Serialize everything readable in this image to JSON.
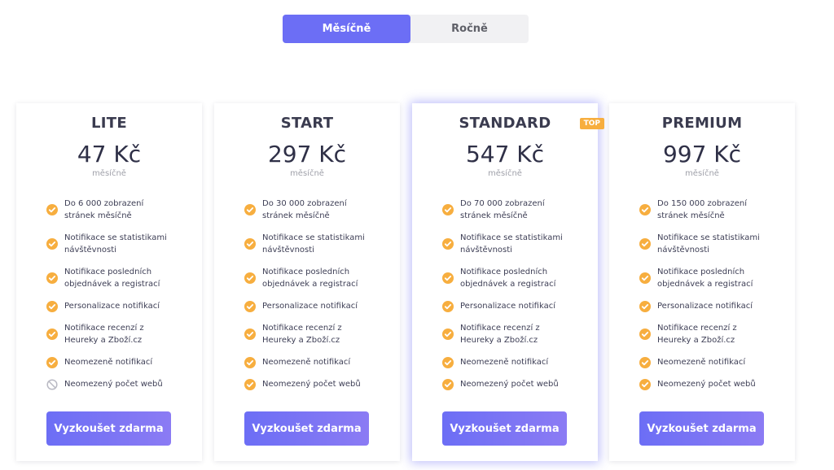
{
  "billing_toggle": {
    "monthly_label": "Měsíčně",
    "yearly_label": "Ročně"
  },
  "colors": {
    "accent": "#6c6ef5",
    "badge": "#f7ae3f",
    "check": "#f7ae3f",
    "disabled": "#b9b9c3"
  },
  "plans": [
    {
      "name": "LITE",
      "price": "47 Kč",
      "period": "měsíčně",
      "button": "Vyzkoušet zdarma",
      "features": [
        {
          "text": "Do 6 000 zobrazení stránek měsíčně",
          "icon": "check-circle-icon"
        },
        {
          "text": "Notifikace se statistikami návštěvnosti",
          "icon": "check-circle-icon"
        },
        {
          "text": "Notifikace posledních objednávek a registrací",
          "icon": "check-circle-icon"
        },
        {
          "text": "Personalizace notifikací",
          "icon": "check-circle-icon"
        },
        {
          "text": "Notifikace recenzí z Heureky a Zboží.cz",
          "icon": "check-circle-icon"
        },
        {
          "text": "Neomezeně notifikací",
          "icon": "check-circle-icon"
        },
        {
          "text": "Neomezený počet webů",
          "icon": "not-allowed-icon"
        }
      ]
    },
    {
      "name": "START",
      "price": "297 Kč",
      "period": "měsíčně",
      "button": "Vyzkoušet zdarma",
      "features": [
        {
          "text": "Do 30 000 zobrazení stránek měsíčně",
          "icon": "check-circle-icon"
        },
        {
          "text": "Notifikace se statistikami návštěvnosti",
          "icon": "check-circle-icon"
        },
        {
          "text": "Notifikace posledních objednávek a registrací",
          "icon": "check-circle-icon"
        },
        {
          "text": "Personalizace notifikací",
          "icon": "check-circle-icon"
        },
        {
          "text": "Notifikace recenzí z Heureky a Zboží.cz",
          "icon": "check-circle-icon"
        },
        {
          "text": "Neomezeně notifikací",
          "icon": "check-circle-icon"
        },
        {
          "text": "Neomezený počet webů",
          "icon": "check-circle-icon"
        }
      ]
    },
    {
      "name": "STANDARD",
      "badge": "TOP",
      "price": "547 Kč",
      "period": "měsíčně",
      "button": "Vyzkoušet zdarma",
      "features": [
        {
          "text": "Do 70 000 zobrazení stránek měsíčně",
          "icon": "check-circle-icon"
        },
        {
          "text": "Notifikace se statistikami návštěvnosti",
          "icon": "check-circle-icon"
        },
        {
          "text": "Notifikace posledních objednávek a registrací",
          "icon": "check-circle-icon"
        },
        {
          "text": "Personalizace notifikací",
          "icon": "check-circle-icon"
        },
        {
          "text": "Notifikace recenzí z Heureky a Zboží.cz",
          "icon": "check-circle-icon"
        },
        {
          "text": "Neomezeně notifikací",
          "icon": "check-circle-icon"
        },
        {
          "text": "Neomezený počet webů",
          "icon": "check-circle-icon"
        }
      ]
    },
    {
      "name": "PREMIUM",
      "price": "997 Kč",
      "period": "měsíčně",
      "button": "Vyzkoušet zdarma",
      "features": [
        {
          "text": "Do 150 000 zobrazení stránek měsíčně",
          "icon": "check-circle-icon"
        },
        {
          "text": "Notifikace se statistikami návštěvnosti",
          "icon": "check-circle-icon"
        },
        {
          "text": "Notifikace posledních objednávek a registrací",
          "icon": "check-circle-icon"
        },
        {
          "text": "Personalizace notifikací",
          "icon": "check-circle-icon"
        },
        {
          "text": "Notifikace recenzí z Heureky a Zboží.cz",
          "icon": "check-circle-icon"
        },
        {
          "text": "Neomezeně notifikací",
          "icon": "check-circle-icon"
        },
        {
          "text": "Neomezený počet webů",
          "icon": "check-circle-icon"
        }
      ]
    }
  ]
}
